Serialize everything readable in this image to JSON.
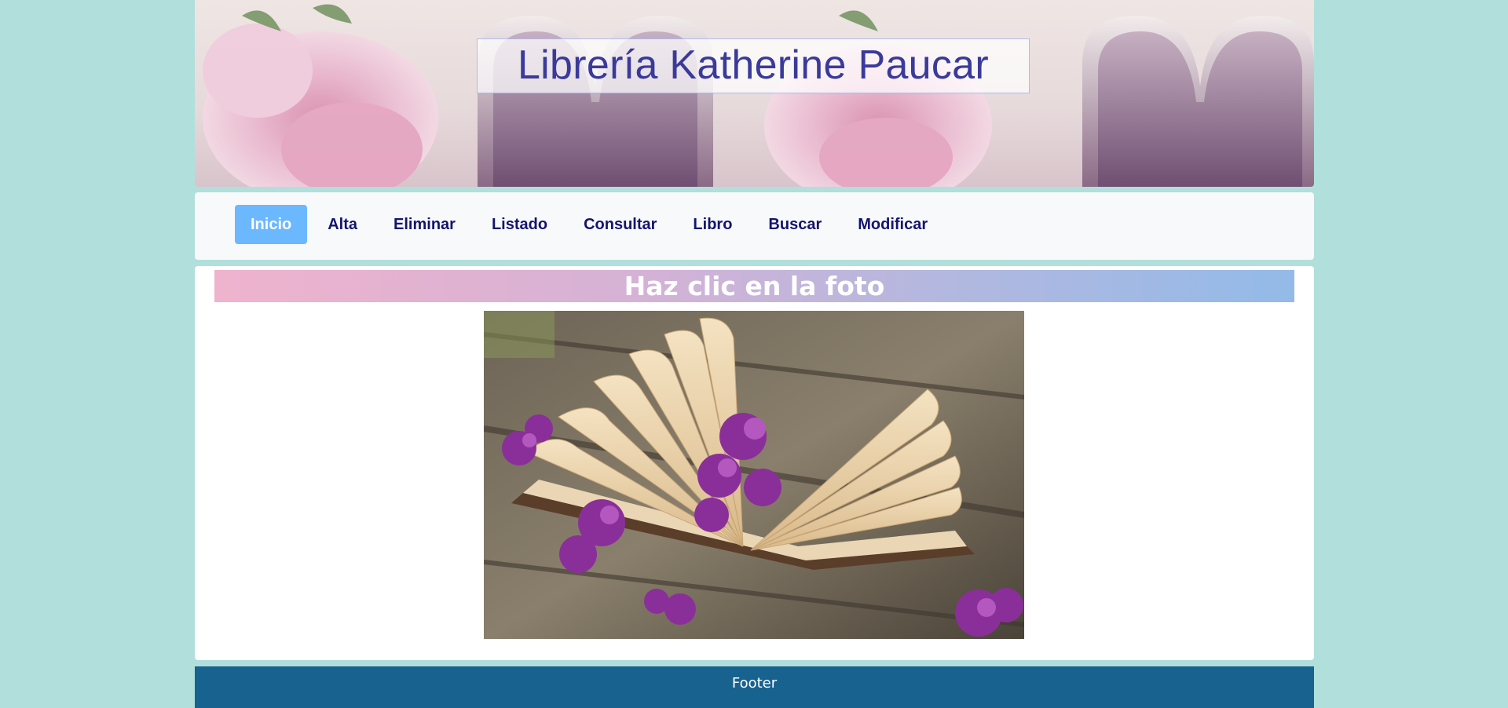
{
  "header": {
    "title": "Librería Katherine Paucar"
  },
  "nav": {
    "items": [
      {
        "label": "Inicio",
        "active": true
      },
      {
        "label": "Alta",
        "active": false
      },
      {
        "label": "Eliminar",
        "active": false
      },
      {
        "label": "Listado",
        "active": false
      },
      {
        "label": "Consultar",
        "active": false
      },
      {
        "label": "Libro",
        "active": false
      },
      {
        "label": "Buscar",
        "active": false
      },
      {
        "label": "Modificar",
        "active": false
      }
    ]
  },
  "main": {
    "heading": "Haz clic en la foto"
  },
  "footer": {
    "text": "Footer"
  },
  "colors": {
    "background": "#b1dfdb",
    "nav_active": "#6bb8ff",
    "nav_text": "#14146e",
    "footer": "#17628f",
    "title_text": "#3a3a9a"
  }
}
